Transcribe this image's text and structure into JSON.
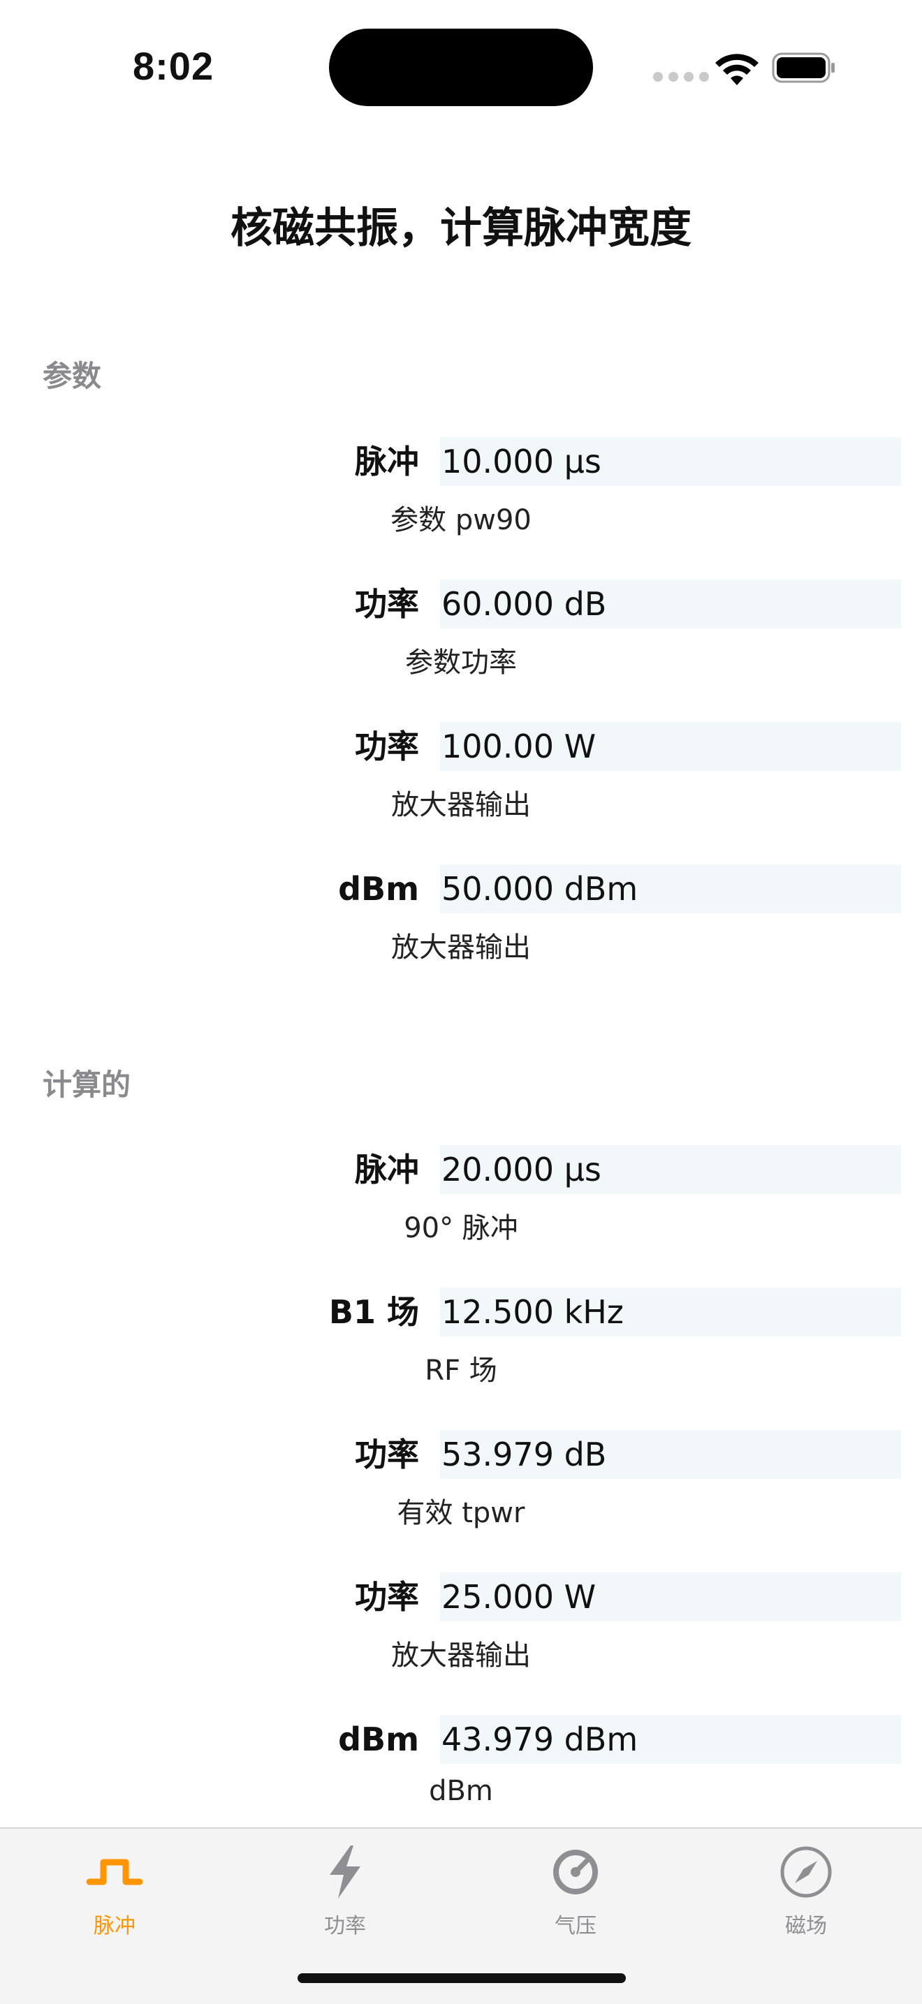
{
  "status_bar": {
    "time": "8:02"
  },
  "title": "核磁共振，计算脉冲宽度",
  "sections": {
    "parameters": {
      "header": "参数",
      "rows": [
        {
          "label": "脉冲",
          "value": "10.000 µs",
          "caption": "参数 pw90"
        },
        {
          "label": "功率",
          "value": "60.000 dB",
          "caption": "参数功率"
        },
        {
          "label": "功率",
          "value": "100.00 W",
          "caption": "放大器输出"
        },
        {
          "label": "dBm",
          "value": "50.000 dBm",
          "caption": "放大器输出"
        }
      ]
    },
    "calculated": {
      "header": "计算的",
      "rows": [
        {
          "label": "脉冲",
          "value": "20.000 µs",
          "caption": "90° 脉冲"
        },
        {
          "label": "B1 场",
          "value": "12.500 kHz",
          "caption": "RF 场"
        },
        {
          "label": "功率",
          "value": "53.979 dB",
          "caption": "有效 tpwr"
        },
        {
          "label": "功率",
          "value": "25.000 W",
          "caption": "放大器输出"
        },
        {
          "label": "dBm",
          "value": "43.979 dBm",
          "caption": "dBm"
        }
      ]
    }
  },
  "tab_bar": {
    "tabs": [
      {
        "label": "脉冲",
        "icon": "pulse-icon",
        "active": true
      },
      {
        "label": "功率",
        "icon": "bolt-icon",
        "active": false
      },
      {
        "label": "气压",
        "icon": "gauge-icon",
        "active": false
      },
      {
        "label": "磁场",
        "icon": "compass-icon",
        "active": false
      }
    ]
  },
  "colors": {
    "accent": "#ff9500",
    "inactive": "#8e8e93",
    "field_background": "#f2f7fa"
  }
}
